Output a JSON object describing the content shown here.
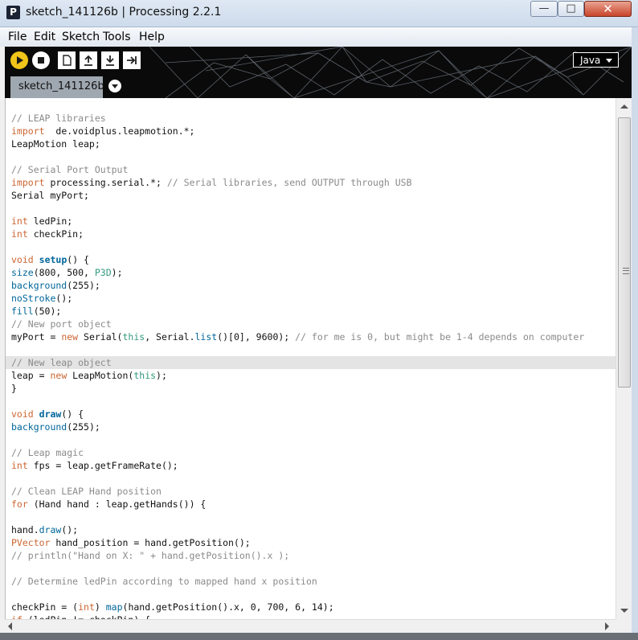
{
  "window": {
    "title": "sketch_141126b | Processing 2.2.1",
    "app_icon_letter": "P",
    "min_symbol": "—",
    "max_symbol": "□",
    "close_symbol": "✕"
  },
  "menu": [
    "File",
    "Edit",
    "Sketch",
    "Tools",
    "Help"
  ],
  "toolbar": {
    "mode": "Java",
    "tab": "sketch_141126b"
  },
  "colors": {
    "run": "#f0c419",
    "comment": "#8a8a8a",
    "keyword": "#cc6633",
    "function": "#006699",
    "literal": "#33997e"
  },
  "code": [
    [
      [
        "c",
        "// LEAP libraries"
      ]
    ],
    [
      [
        "k",
        "import"
      ],
      [
        "",
        "  de.voidplus.leapmotion.*;"
      ]
    ],
    [
      [
        "",
        "LeapMotion leap;"
      ]
    ],
    [],
    [
      [
        "c",
        "// Serial Port Output"
      ]
    ],
    [
      [
        "k",
        "import"
      ],
      [
        "",
        " processing.serial.*; "
      ],
      [
        "c",
        "// Serial libraries, send OUTPUT through USB"
      ]
    ],
    [
      [
        "",
        "Serial myPort;"
      ]
    ],
    [],
    [
      [
        "k",
        "int"
      ],
      [
        "",
        " ledPin;"
      ]
    ],
    [
      [
        "k",
        "int"
      ],
      [
        "",
        " checkPin;"
      ]
    ],
    [],
    [
      [
        "k",
        "void"
      ],
      [
        "",
        " "
      ],
      [
        "fb",
        "setup"
      ],
      [
        "",
        "() {"
      ]
    ],
    [
      [
        "f",
        "size"
      ],
      [
        "",
        "(800, 500, "
      ],
      [
        "n",
        "P3D"
      ],
      [
        "",
        ");"
      ]
    ],
    [
      [
        "f",
        "background"
      ],
      [
        "",
        "(255);"
      ]
    ],
    [
      [
        "f",
        "noStroke"
      ],
      [
        "",
        "();"
      ]
    ],
    [
      [
        "f",
        "fill"
      ],
      [
        "",
        "(50);"
      ]
    ],
    [
      [
        "c",
        "// New port object"
      ]
    ],
    [
      [
        "",
        "myPort = "
      ],
      [
        "k",
        "new"
      ],
      [
        "",
        " Serial("
      ],
      [
        "n",
        "this"
      ],
      [
        "",
        ", Serial."
      ],
      [
        "f",
        "list"
      ],
      [
        "",
        "()[0], 9600); "
      ],
      [
        "c",
        "// for me is 0, but might be 1-4 depends on computer"
      ]
    ],
    [],
    [
      [
        "c",
        "// New leap object"
      ]
    ],
    [
      [
        "",
        "leap = "
      ],
      [
        "k",
        "new"
      ],
      [
        "",
        " LeapMotion("
      ],
      [
        "n",
        "this"
      ],
      [
        "",
        ");"
      ]
    ],
    [
      [
        "",
        "}"
      ]
    ],
    [],
    [
      [
        "k",
        "void"
      ],
      [
        "",
        " "
      ],
      [
        "fb",
        "draw"
      ],
      [
        "",
        "() {"
      ]
    ],
    [
      [
        "f",
        "background"
      ],
      [
        "",
        "(255);"
      ]
    ],
    [],
    [
      [
        "c",
        "// Leap magic"
      ]
    ],
    [
      [
        "k",
        "int"
      ],
      [
        "",
        " fps = leap.getFrameRate();"
      ]
    ],
    [],
    [
      [
        "c",
        "// Clean LEAP Hand position"
      ]
    ],
    [
      [
        "k",
        "for"
      ],
      [
        "",
        " (Hand hand : leap.getHands()) {"
      ]
    ],
    [],
    [
      [
        "",
        "hand."
      ],
      [
        "f",
        "draw"
      ],
      [
        "",
        "();"
      ]
    ],
    [
      [
        "k",
        "PVector"
      ],
      [
        "",
        " hand_position = hand.getPosition();"
      ]
    ],
    [
      [
        "c",
        "// println(\"Hand on X: \" + hand.getPosition().x );"
      ]
    ],
    [],
    [
      [
        "c",
        "// Determine ledPin according to mapped hand x position"
      ]
    ],
    [],
    [
      [
        "",
        "checkPin = ("
      ],
      [
        "k",
        "int"
      ],
      [
        "",
        ") "
      ],
      [
        "f",
        "map"
      ],
      [
        "",
        "(hand.getPosition().x, 0, 700, 6, 14);"
      ]
    ],
    [
      [
        "k",
        "if"
      ],
      [
        "",
        " (ledPin != checkPin) {"
      ]
    ]
  ]
}
